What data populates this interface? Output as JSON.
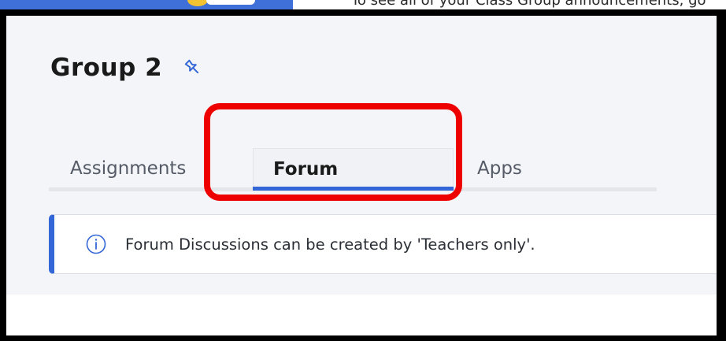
{
  "top_strip": {
    "clipped_text": "To see all of your Class Group announcements, go"
  },
  "header": {
    "title": "Group 2",
    "pin_icon": "pin-icon"
  },
  "tabs": [
    {
      "label": "Assignments",
      "active": false
    },
    {
      "label": "Forum",
      "active": true
    },
    {
      "label": "Apps",
      "active": false
    }
  ],
  "notice": {
    "icon": "info-icon",
    "text": "Forum Discussions can be created by 'Teachers only'."
  },
  "colors": {
    "accent": "#3366d6",
    "highlight": "#ee0000",
    "background": "#f4f5f8"
  }
}
